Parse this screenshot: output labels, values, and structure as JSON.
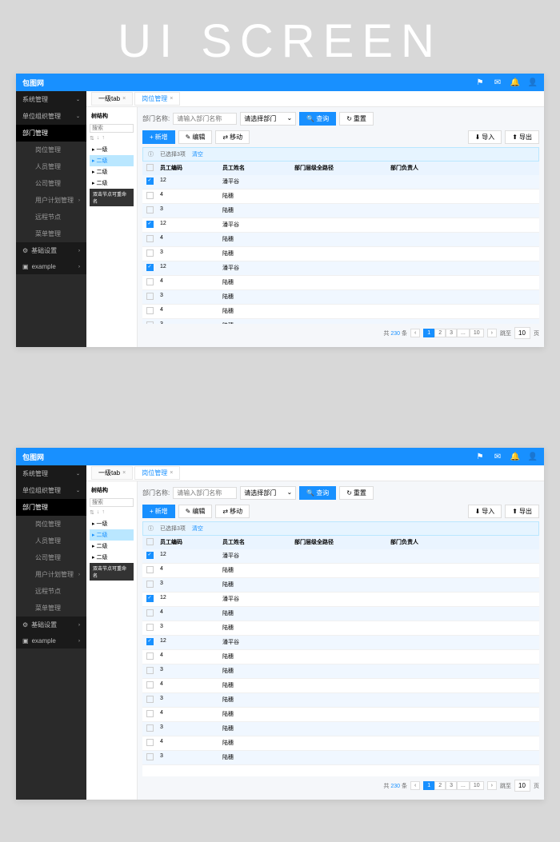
{
  "title": "UI SCREEN",
  "brand": "包图网",
  "sidebar": {
    "items": [
      {
        "label": "系统管理",
        "type": "top",
        "arrow": "⌄"
      },
      {
        "label": "单位组织管理",
        "type": "top",
        "arrow": "⌄"
      },
      {
        "label": "部门管理",
        "type": "active"
      },
      {
        "label": "岗位管理",
        "type": "sub"
      },
      {
        "label": "人员管理",
        "type": "sub"
      },
      {
        "label": "公司管理",
        "type": "sub"
      },
      {
        "label": "用户计划管理",
        "type": "sub",
        "arrow": "›"
      },
      {
        "label": "远程节点",
        "type": "sub"
      },
      {
        "label": "菜单管理",
        "type": "sub"
      },
      {
        "label": "基础设置",
        "type": "top",
        "arrow": "›",
        "icon": "⚙"
      },
      {
        "label": "example",
        "type": "top",
        "arrow": "›",
        "icon": "▣"
      }
    ]
  },
  "tabs": [
    {
      "label": "一级tab",
      "active": false
    },
    {
      "label": "岗位管理",
      "active": true
    }
  ],
  "tree": {
    "title": "树结构",
    "search_placeholder": "搜索",
    "nodes": [
      {
        "label": "一级"
      },
      {
        "label": "二级",
        "selected": true
      },
      {
        "label": "二级"
      },
      {
        "label": "二级"
      }
    ],
    "tooltip": "双击节点可重命名"
  },
  "filter": {
    "label": "部门名称:",
    "input_placeholder": "请输入部门名称",
    "select_placeholder": "请选择部门",
    "search_btn": "查询",
    "reset_btn": "重置"
  },
  "toolbar": {
    "add": "新增",
    "edit": "编辑",
    "move": "移动",
    "import": "导入",
    "export": "导出"
  },
  "selection": {
    "text": "已选择3项",
    "clear": "清空"
  },
  "table": {
    "columns": [
      "员工编码",
      "员工姓名",
      "部门层级全路径",
      "部门负责人"
    ],
    "rows": [
      {
        "id": "12",
        "name": "潘平谷",
        "checked": true
      },
      {
        "id": "4",
        "name": "陆穗",
        "checked": false
      },
      {
        "id": "3",
        "name": "陆穗",
        "checked": false
      },
      {
        "id": "12",
        "name": "潘平谷",
        "checked": true
      },
      {
        "id": "4",
        "name": "陆穗",
        "checked": false
      },
      {
        "id": "3",
        "name": "陆穗",
        "checked": false
      },
      {
        "id": "12",
        "name": "潘平谷",
        "checked": true
      },
      {
        "id": "4",
        "name": "陆穗",
        "checked": false
      },
      {
        "id": "3",
        "name": "陆穗",
        "checked": false
      },
      {
        "id": "4",
        "name": "陆穗",
        "checked": false
      },
      {
        "id": "3",
        "name": "陆穗",
        "checked": false
      },
      {
        "id": "4",
        "name": "陆穗",
        "checked": false
      },
      {
        "id": "3",
        "name": "陆穗",
        "checked": false
      },
      {
        "id": "4",
        "name": "陆穗",
        "checked": false
      },
      {
        "id": "3",
        "name": "陆穗",
        "checked": false
      }
    ]
  },
  "pagination": {
    "total_prefix": "共",
    "total_count": "230",
    "total_suffix": "条",
    "pages": [
      "1",
      "2",
      "3",
      "...",
      "10"
    ],
    "jump_label": "跳至",
    "jump_value": "10",
    "page_unit": "页"
  }
}
